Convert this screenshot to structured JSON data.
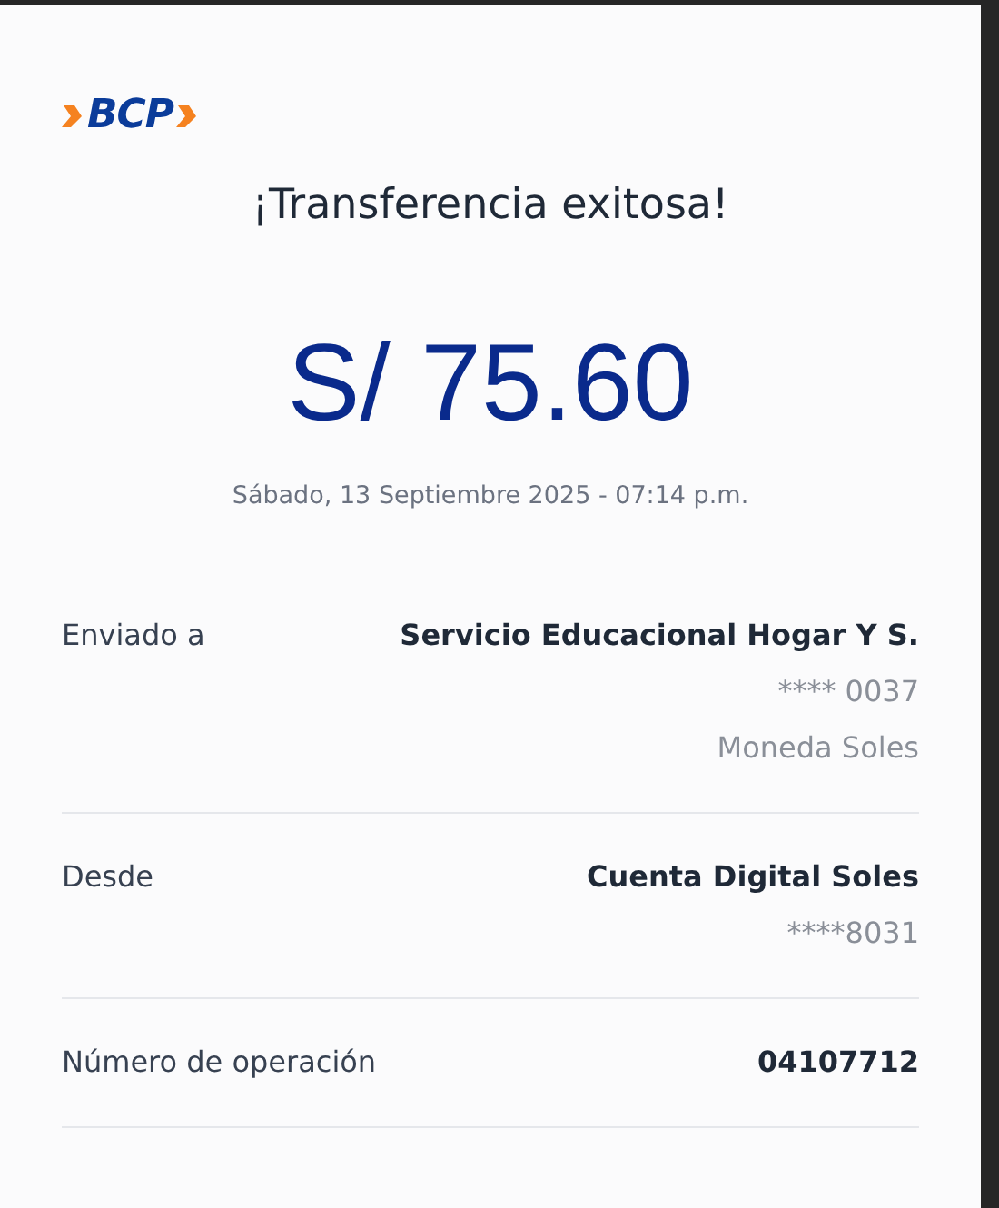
{
  "logo": {
    "text": "BCP"
  },
  "title": "¡Transferencia exitosa!",
  "amount": "S/ 75.60",
  "date": "Sábado, 13 Septiembre 2025 - 07:14 p.m.",
  "details": [
    {
      "label": "Enviado a",
      "values": [
        {
          "kind": "strong",
          "text": "Servicio Educacional Hogar Y S."
        },
        {
          "kind": "muted",
          "text": "**** 0037"
        },
        {
          "kind": "muted",
          "text": "Moneda Soles"
        }
      ]
    },
    {
      "label": "Desde",
      "values": [
        {
          "kind": "strong",
          "text": "Cuenta Digital Soles"
        },
        {
          "kind": "muted",
          "text": "****8031"
        }
      ]
    },
    {
      "label": "Número de operación",
      "values": [
        {
          "kind": "strong",
          "text": "04107712"
        }
      ]
    }
  ]
}
